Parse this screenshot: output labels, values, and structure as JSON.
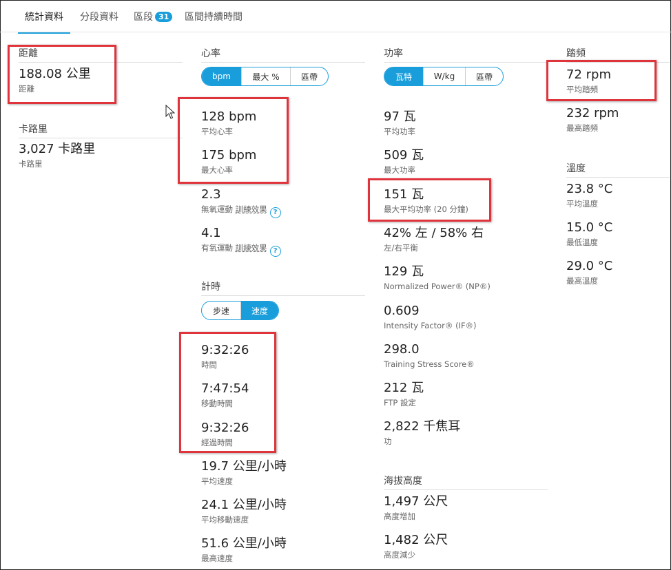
{
  "tabs": [
    {
      "label": "統計資料",
      "active": true
    },
    {
      "label": "分段資料",
      "active": false
    },
    {
      "label": "區段",
      "badge": "31",
      "active": false
    },
    {
      "label": "區間持續時間",
      "active": false
    }
  ],
  "distance": {
    "title": "距離",
    "value": "188.08 公里",
    "label": "距離"
  },
  "calories": {
    "title": "卡路里",
    "value": "3,027 卡路里",
    "label": "卡路里"
  },
  "heart_rate": {
    "title": "心率",
    "toggle": [
      "bpm",
      "最大 %",
      "區帶"
    ],
    "avg": {
      "value": "128 bpm",
      "label": "平均心率"
    },
    "max": {
      "value": "175 bpm",
      "label": "最大心率"
    },
    "anaerobic": {
      "value": "2.3",
      "label_prefix": "無氧運動 ",
      "label_link": "訓練效果"
    },
    "aerobic": {
      "value": "4.1",
      "label_prefix": "有氧運動 ",
      "label_link": "訓練效果"
    }
  },
  "timing": {
    "title": "計時",
    "toggle": [
      "步速",
      "速度"
    ],
    "time": {
      "value": "9:32:26",
      "label": "時間"
    },
    "moving": {
      "value": "7:47:54",
      "label": "移動時間"
    },
    "elapsed": {
      "value": "9:32:26",
      "label": "經過時間"
    },
    "avg_speed": {
      "value": "19.7 公里/小時",
      "label": "平均速度"
    },
    "avg_moving_speed": {
      "value": "24.1 公里/小時",
      "label": "平均移動速度"
    },
    "max_speed": {
      "value": "51.6 公里/小時",
      "label": "最高速度"
    }
  },
  "power": {
    "title": "功率",
    "toggle": [
      "瓦特",
      "W/kg",
      "區帶"
    ],
    "avg": {
      "value": "97 瓦",
      "label": "平均功率"
    },
    "max": {
      "value": "509 瓦",
      "label": "最大功率"
    },
    "max20": {
      "value": "151 瓦",
      "label": "最大平均功率 (20 分鐘)"
    },
    "balance": {
      "value": "42% 左 / 58% 右",
      "label": "左/右平衡"
    },
    "np": {
      "value": "129 瓦",
      "label": "Normalized Power® (NP®)"
    },
    "if": {
      "value": "0.609",
      "label": "Intensity Factor® (IF®)"
    },
    "tss": {
      "value": "298.0",
      "label": "Training Stress Score®"
    },
    "ftp": {
      "value": "212 瓦",
      "label": "FTP 設定"
    },
    "work": {
      "value": "2,822 千焦耳",
      "label": "功"
    }
  },
  "elevation": {
    "title": "海拔高度",
    "gain": {
      "value": "1,497 公尺",
      "label": "高度增加"
    },
    "loss": {
      "value": "1,482 公尺",
      "label": "高度減少"
    }
  },
  "cadence": {
    "title": "踏頻",
    "avg": {
      "value": "72 rpm",
      "label": "平均踏頻"
    },
    "max": {
      "value": "232 rpm",
      "label": "最高踏頻"
    }
  },
  "temperature": {
    "title": "溫度",
    "avg": {
      "value": "23.8 °C",
      "label": "平均溫度"
    },
    "min": {
      "value": "15.0 °C",
      "label": "最低溫度"
    },
    "max": {
      "value": "29.0 °C",
      "label": "最高溫度"
    }
  },
  "colors": {
    "accent": "#1a9edb",
    "highlight": "#e0343c"
  }
}
